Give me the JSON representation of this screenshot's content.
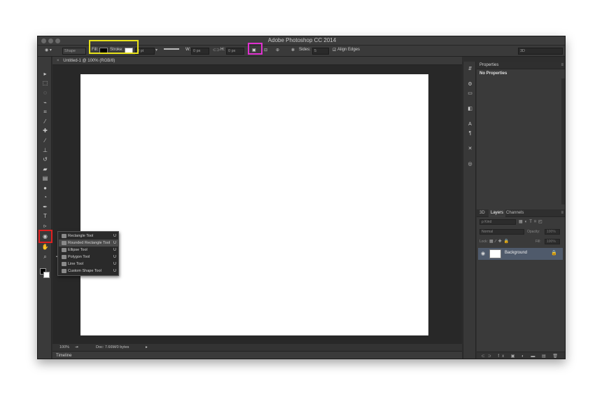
{
  "window": {
    "title": "Adobe Photoshop CC 2014"
  },
  "options_bar": {
    "shape_mode": "Shape",
    "fill_label": "Fill:",
    "stroke_label": "Stroke:",
    "stroke_width": "3 pt",
    "w_label": "W:",
    "w_value": "0 px",
    "h_label": "H:",
    "h_value": "0 px",
    "sides_label": "Sides:",
    "sides_value": "5",
    "align_edges_label": "Align Edges",
    "align_edges_checked": true,
    "workspace": "3D"
  },
  "document": {
    "tab_title": "Untitled-1 @ 100% (RGB/8)",
    "canvas_color": "#ffffff"
  },
  "status_bar": {
    "zoom": "100%",
    "doc_info": "Doc: 7.66M/0 bytes"
  },
  "timeline": {
    "label": "Timeline"
  },
  "tools": [
    {
      "name": "move-tool-icon",
      "glyph": "▸"
    },
    {
      "name": "marquee-tool-icon",
      "glyph": "⬚"
    },
    {
      "name": "lasso-tool-icon",
      "glyph": "◌"
    },
    {
      "name": "quick-select-tool-icon",
      "glyph": "⌁"
    },
    {
      "name": "crop-tool-icon",
      "glyph": "⌗"
    },
    {
      "name": "eyedropper-tool-icon",
      "glyph": "⁄"
    },
    {
      "name": "healing-brush-tool-icon",
      "glyph": "✚"
    },
    {
      "name": "brush-tool-icon",
      "glyph": "∕"
    },
    {
      "name": "clone-stamp-tool-icon",
      "glyph": "⊥"
    },
    {
      "name": "history-brush-tool-icon",
      "glyph": "↺"
    },
    {
      "name": "eraser-tool-icon",
      "glyph": "▰"
    },
    {
      "name": "gradient-tool-icon",
      "glyph": "▤"
    },
    {
      "name": "blur-tool-icon",
      "glyph": "●"
    },
    {
      "name": "dodge-tool-icon",
      "glyph": "◔"
    },
    {
      "name": "pen-tool-icon",
      "glyph": "✒"
    },
    {
      "name": "type-tool-icon",
      "glyph": "T"
    },
    {
      "name": "path-select-tool-icon",
      "glyph": "▹"
    },
    {
      "name": "shape-tool-icon",
      "glyph": "◉"
    },
    {
      "name": "hand-tool-icon",
      "glyph": "✋"
    },
    {
      "name": "zoom-tool-icon",
      "glyph": "⌕"
    }
  ],
  "shape_flyout": {
    "items": [
      {
        "label": "Rectangle Tool",
        "key": "U",
        "active": false,
        "current": false
      },
      {
        "label": "Rounded Rectangle Tool",
        "key": "U",
        "active": true,
        "current": false
      },
      {
        "label": "Ellipse Tool",
        "key": "U",
        "active": false,
        "current": false
      },
      {
        "label": "Polygon Tool",
        "key": "U",
        "active": false,
        "current": true
      },
      {
        "label": "Line Tool",
        "key": "U",
        "active": false,
        "current": false
      },
      {
        "label": "Custom Shape Tool",
        "key": "U",
        "active": false,
        "current": false
      }
    ]
  },
  "properties_panel": {
    "tab": "Properties",
    "content": "No Properties"
  },
  "layers_panel": {
    "tabs": [
      "3D",
      "Layers",
      "Channels"
    ],
    "active_tab": "Layers",
    "filter_label": "ρ Kind",
    "blend_mode": "Normal",
    "opacity_label": "Opacity:",
    "opacity_value": "100%",
    "lock_label": "Lock:",
    "fill_label": "Fill:",
    "fill_value": "100%",
    "layers": [
      {
        "name": "Background",
        "visible": true,
        "locked": true
      }
    ]
  },
  "colors": {
    "highlight_yellow": "#e8e21a",
    "highlight_magenta": "#e030d0",
    "highlight_red": "#e02020",
    "selected_layer": "#4f5a6b"
  }
}
